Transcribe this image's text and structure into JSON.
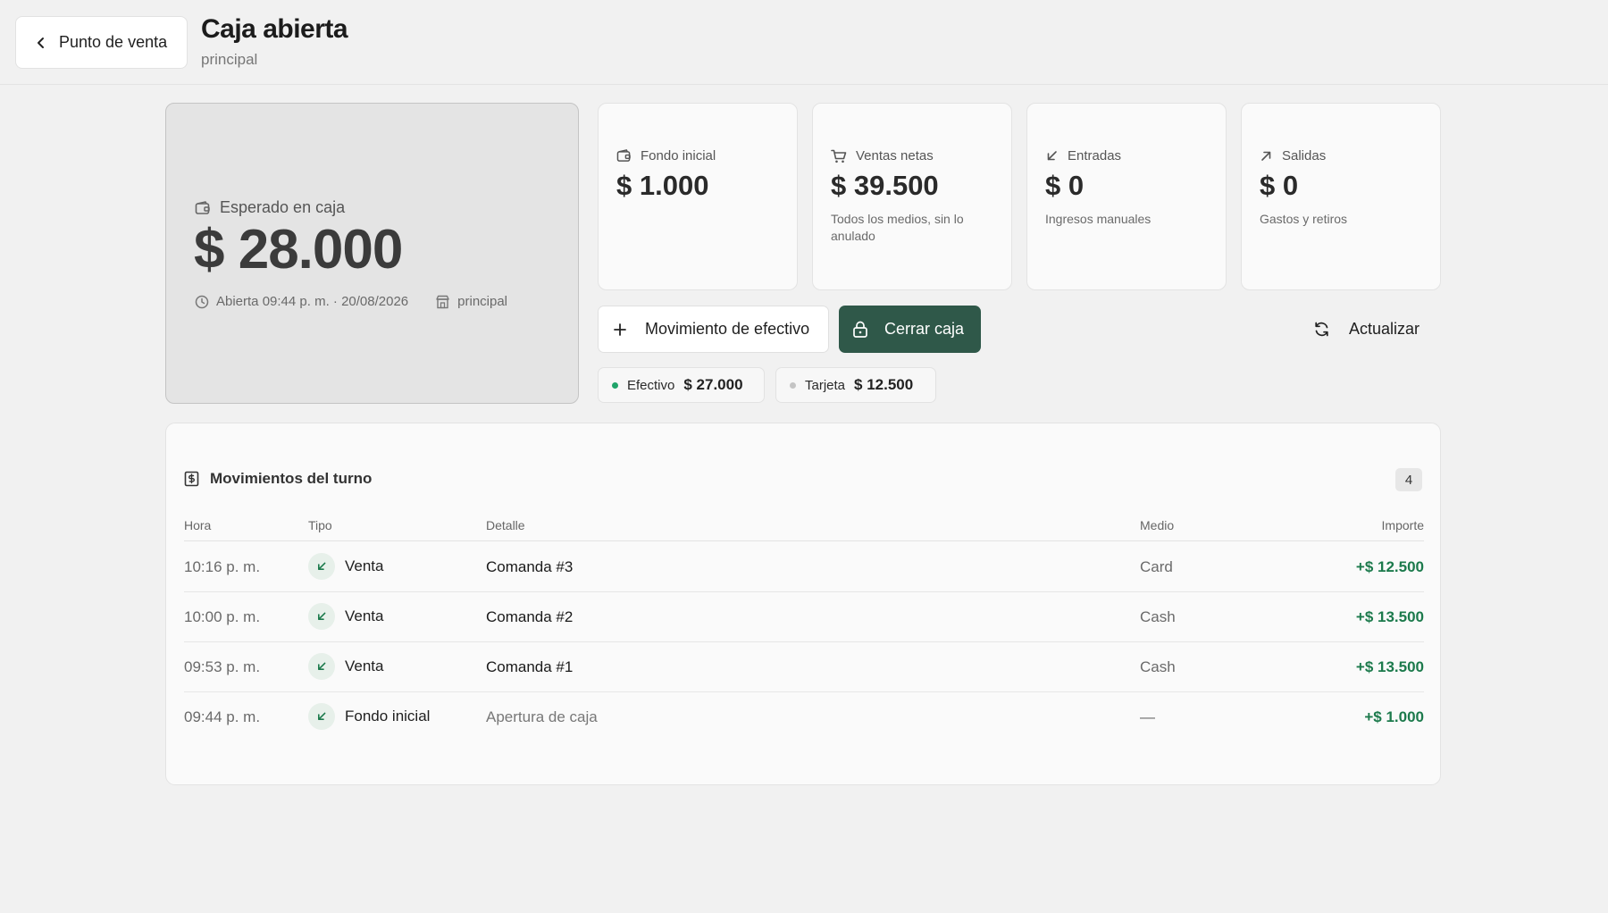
{
  "header": {
    "back_label": "Punto de venta",
    "title": "Caja abierta",
    "subtitle": "principal"
  },
  "expected": {
    "label": "Esperado en caja",
    "amount": "$ 28.000",
    "opened": "Abierta 09:44 p. m. · 20/08/2026",
    "location": "principal"
  },
  "stats": [
    {
      "label": "Fondo inicial",
      "value": "$ 1.000",
      "desc": "",
      "icon": "wallet-icon"
    },
    {
      "label": "Ventas netas",
      "value": "$ 39.500",
      "desc": "Todos los medios, sin lo anulado",
      "icon": "cart-icon"
    },
    {
      "label": "Entradas",
      "value": "$ 0",
      "desc": "Ingresos manuales",
      "icon": "arrow-down-left-icon"
    },
    {
      "label": "Salidas",
      "value": "$ 0",
      "desc": "Gastos y retiros",
      "icon": "arrow-up-right-icon"
    }
  ],
  "actions": {
    "move_label": "Movimiento de efectivo",
    "close_label": "Cerrar caja",
    "refresh_label": "Actualizar"
  },
  "payment_pills": [
    {
      "label": "Efectivo",
      "amount": "$ 27.000",
      "dot_color": "#1fa46a"
    },
    {
      "label": "Tarjeta",
      "amount": "$ 12.500",
      "dot_color": "#c4c4c4"
    }
  ],
  "movements": {
    "title": "Movimientos del turno",
    "count": "4",
    "columns": {
      "hora": "Hora",
      "tipo": "Tipo",
      "detalle": "Detalle",
      "medio": "Medio",
      "importe": "Importe"
    },
    "rows": [
      {
        "hora": "10:16 p. m.",
        "tipo": "Venta",
        "detalle": "Comanda #3",
        "medio": "Card",
        "importe": "+$ 12.500"
      },
      {
        "hora": "10:00 p. m.",
        "tipo": "Venta",
        "detalle": "Comanda #2",
        "medio": "Cash",
        "importe": "+$ 13.500"
      },
      {
        "hora": "09:53 p. m.",
        "tipo": "Venta",
        "detalle": "Comanda #1",
        "medio": "Cash",
        "importe": "+$ 13.500"
      },
      {
        "hora": "09:44 p. m.",
        "tipo": "Fondo inicial",
        "detalle": "Apertura de caja",
        "medio": "—",
        "importe": "+$ 1.000"
      }
    ]
  },
  "colors": {
    "accent": "#2f5849",
    "positive": "#1c7a4c"
  }
}
